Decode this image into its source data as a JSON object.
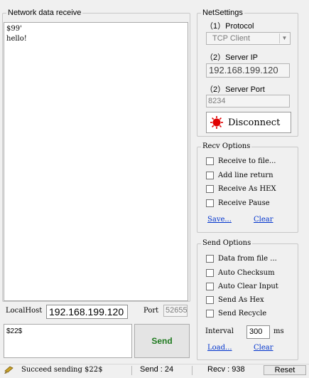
{
  "receive": {
    "legend": "Network data receive",
    "text": "$99'\nhello!"
  },
  "local": {
    "label": "LocalHost",
    "ip": "192.168.199.120",
    "port_label": "Port",
    "port": "52655"
  },
  "send_box": {
    "text": "$22$",
    "button": "Send"
  },
  "net_settings": {
    "legend": "NetSettings",
    "protocol_label": "（1）Protocol",
    "protocol_value": "TCP Client",
    "server_ip_label": "（2）Server IP",
    "server_ip": "192.168.199.120",
    "server_port_label": "（2）Server Port",
    "server_port": "8234",
    "disconnect": "Disconnect",
    "status_color": "#e00000"
  },
  "recv_options": {
    "legend": "Recv Options",
    "items": [
      "Receive to file...",
      "Add line return",
      "Receive As HEX",
      "Receive Pause"
    ],
    "save": "Save...",
    "clear": "Clear"
  },
  "send_options": {
    "legend": "Send Options",
    "items": [
      "Data from file ...",
      "Auto Checksum",
      "Auto Clear Input",
      "Send As Hex",
      "Send Recycle"
    ],
    "interval_label": "Interval",
    "interval_value": "300",
    "interval_unit": "ms",
    "load": "Load...",
    "clear": "Clear"
  },
  "status": {
    "message": "Succeed sending $22$",
    "send": "Send : 24",
    "recv": "Recv : 938",
    "reset": "Reset"
  },
  "colors": {
    "link": "#0033cc",
    "send_button_text": "#1f7a1f"
  }
}
